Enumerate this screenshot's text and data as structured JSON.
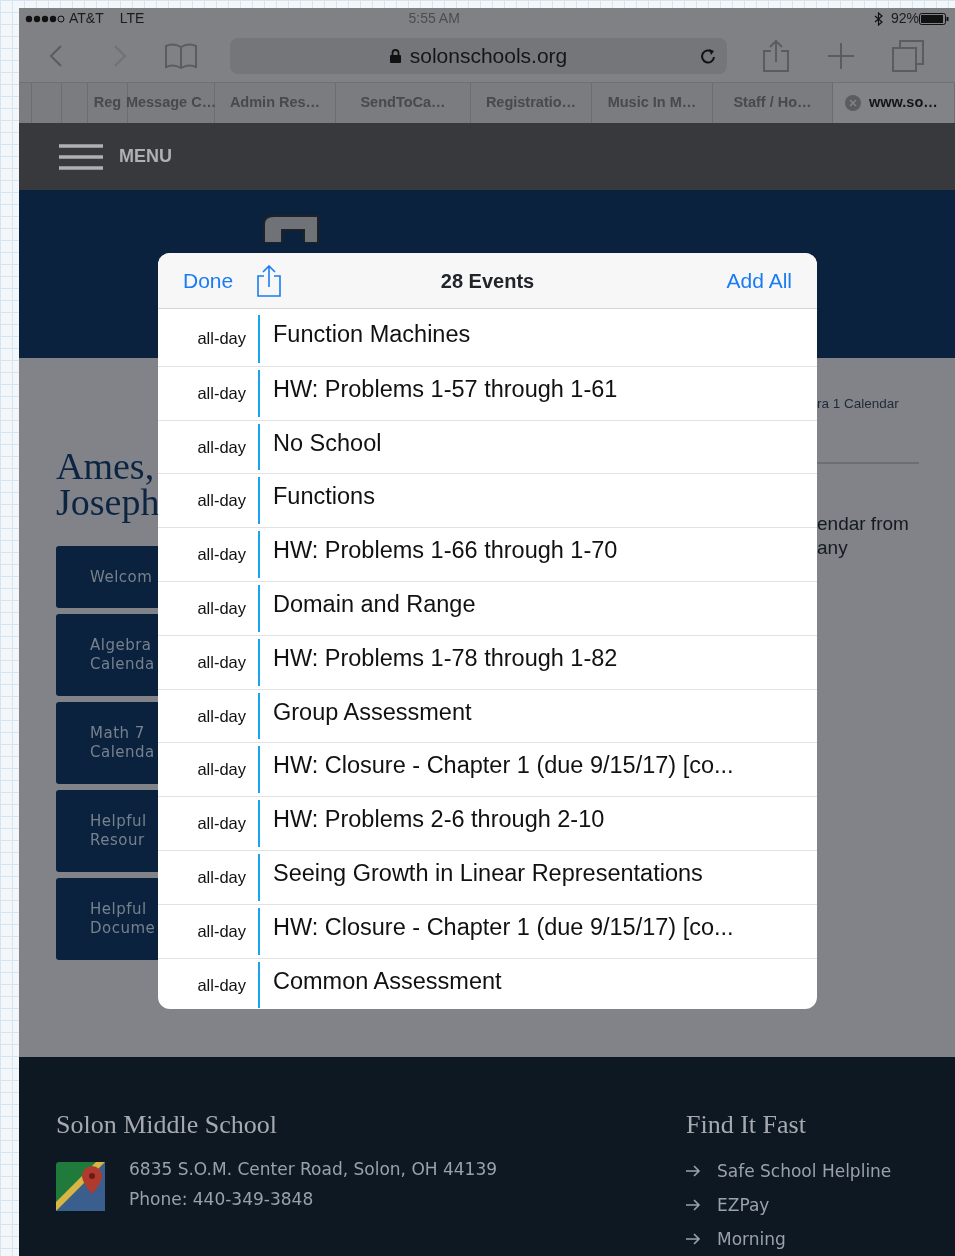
{
  "status_bar": {
    "carrier": "AT&T",
    "network": "LTE",
    "time": "5:55 AM",
    "battery": "92%"
  },
  "browser": {
    "url": "solonschools.org",
    "tabs": [
      {
        "label": "Reg",
        "selected": false
      },
      {
        "label": "Message C…",
        "selected": false
      },
      {
        "label": "Admin Res…",
        "selected": false
      },
      {
        "label": "SendToCa…",
        "selected": false
      },
      {
        "label": "Registratio…",
        "selected": false
      },
      {
        "label": "Music In M…",
        "selected": false
      },
      {
        "label": "Staff / Ho…",
        "selected": false
      },
      {
        "label": "www.so…",
        "selected": true
      }
    ]
  },
  "site": {
    "menu_label": "MENU",
    "heading": [
      "Ames,",
      "Joseph"
    ],
    "nav_buttons": [
      [
        "Welcom"
      ],
      [
        "Algebra",
        "Calenda"
      ],
      [
        "Math 7",
        "Calenda"
      ],
      [
        "Helpful",
        "Resour"
      ],
      [
        "Helpful",
        "Docume"
      ]
    ],
    "side_link": "ra 1 Calendar",
    "side_text": [
      "endar from",
      "any"
    ]
  },
  "modal": {
    "done": "Done",
    "title": "28 Events",
    "add_all": "Add All",
    "events": [
      {
        "time": "all-day",
        "title": "Function Machines"
      },
      {
        "time": "all-day",
        "title": "HW: Problems 1-57 through 1-61"
      },
      {
        "time": "all-day",
        "title": "No School"
      },
      {
        "time": "all-day",
        "title": "Functions"
      },
      {
        "time": "all-day",
        "title": "HW: Problems 1-66 through 1-70"
      },
      {
        "time": "all-day",
        "title": "Domain and Range"
      },
      {
        "time": "all-day",
        "title": "HW: Problems 1-78 through 1-82"
      },
      {
        "time": "all-day",
        "title": "Group Assessment"
      },
      {
        "time": "all-day",
        "title": "HW: Closure - Chapter 1 (due 9/15/17) [co..."
      },
      {
        "time": "all-day",
        "title": "HW: Problems 2-6 through 2-10"
      },
      {
        "time": "all-day",
        "title": "Seeing Growth in Linear Representations"
      },
      {
        "time": "all-day",
        "title": "HW: Closure - Chapter 1 (due 9/15/17) [co..."
      },
      {
        "time": "all-day",
        "title": "Common Assessment"
      }
    ]
  },
  "footer": {
    "school": "Solon Middle School",
    "address": "6835 S.O.M. Center Road, Solon, OH 44139",
    "phone": "Phone: 440-349-3848",
    "links_title": "Find It Fast",
    "links": [
      "Safe School Helpline",
      "EZPay",
      "Morning"
    ]
  }
}
